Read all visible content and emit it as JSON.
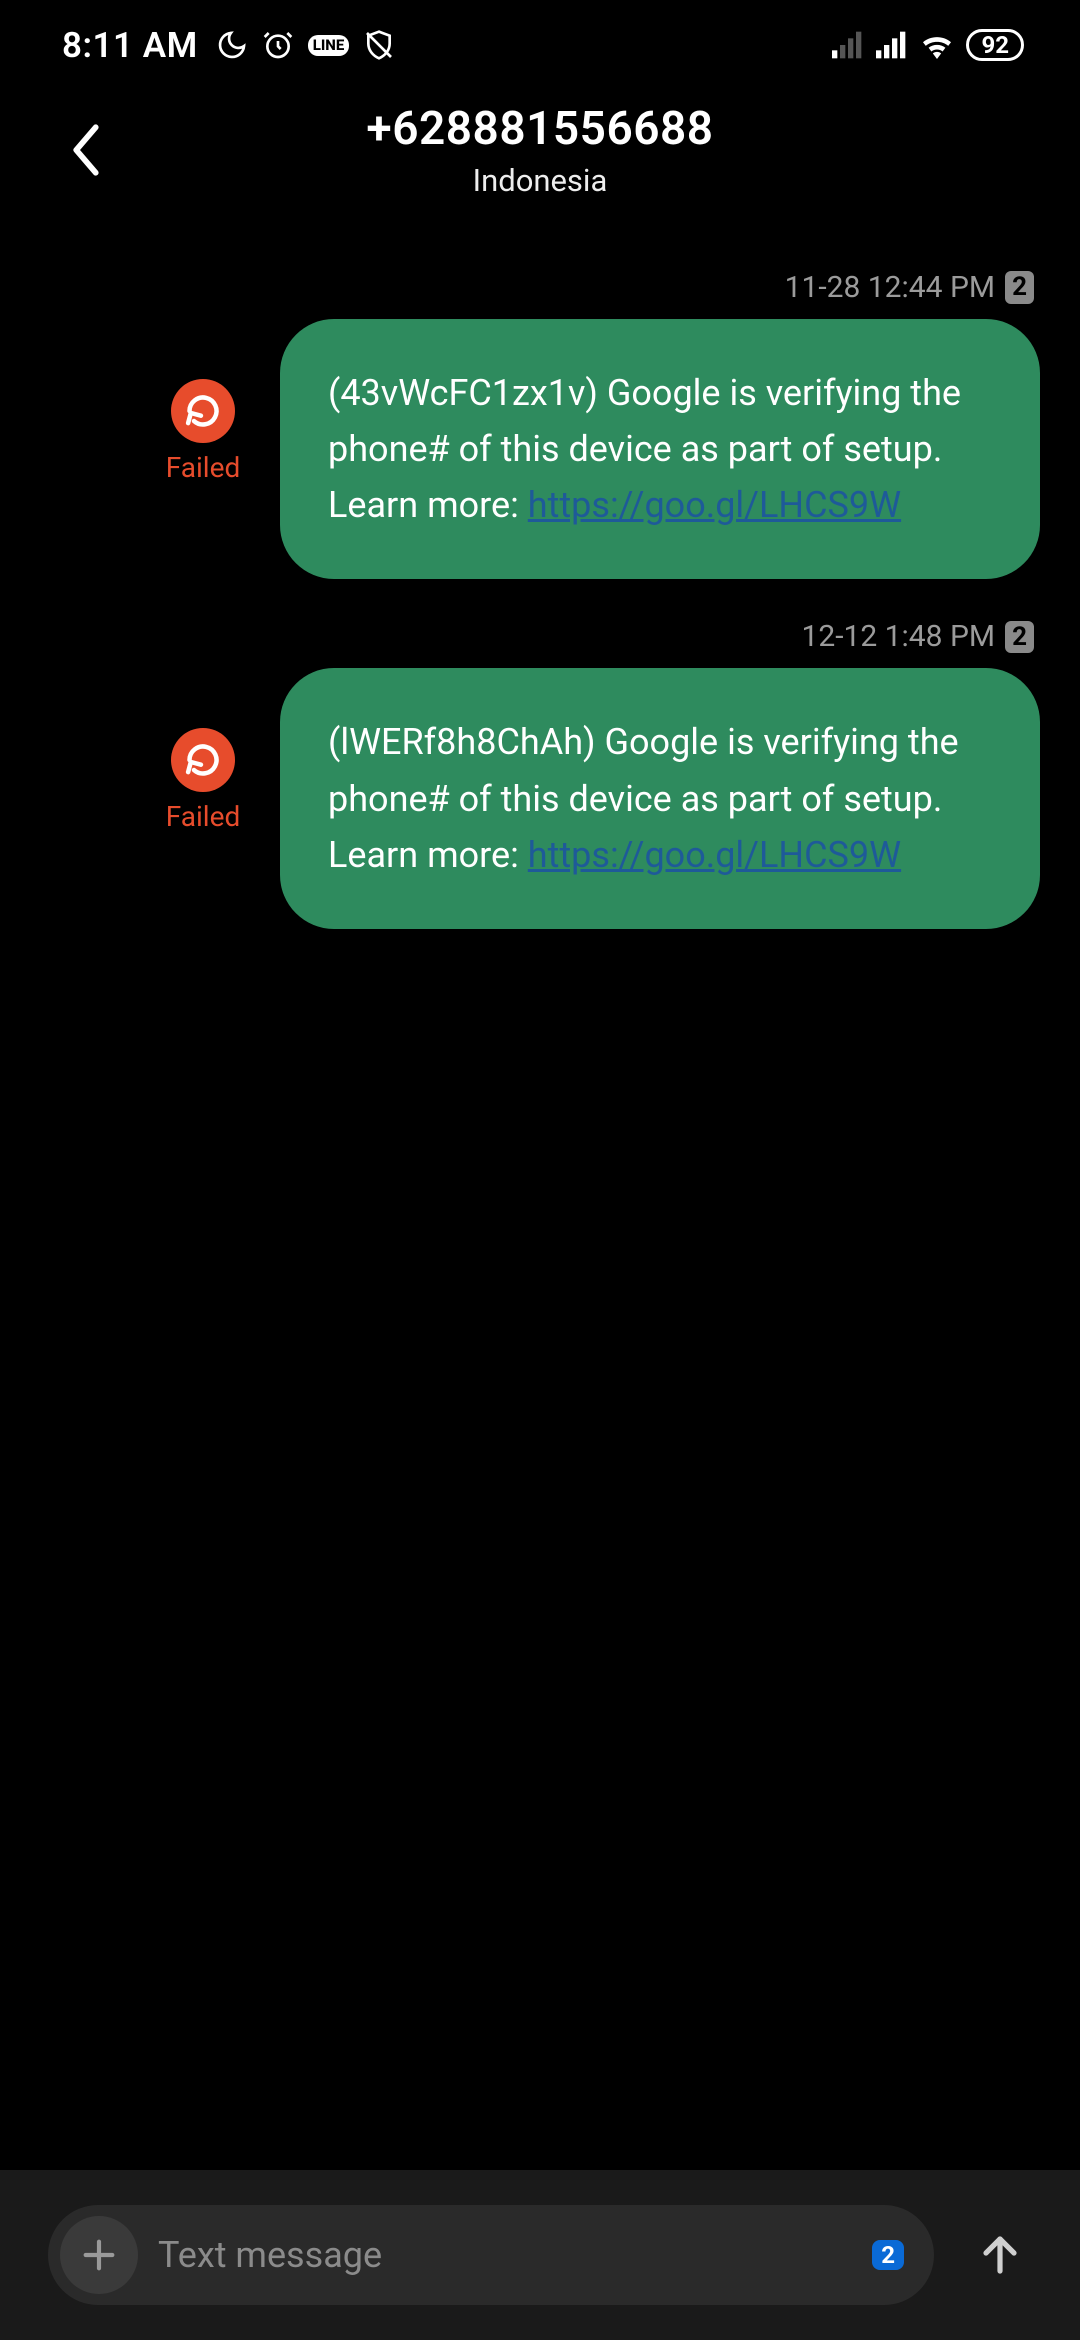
{
  "status": {
    "time": "8:11 AM",
    "battery": "92",
    "icons": {
      "moon": "moon-icon",
      "alarm": "alarm-icon",
      "line": "LINE",
      "shield": "shield-icon",
      "signal1": "signal-weak-icon",
      "signal2": "signal-icon",
      "wifi": "wifi-icon"
    }
  },
  "header": {
    "number": "+628881556688",
    "region": "Indonesia"
  },
  "messages": [
    {
      "time": "11-28 12:44 PM",
      "sim": "2",
      "failed_label": "Failed",
      "text": "(43vWcFC1zx1v) Google is verifying the phone# of this device as part of setup. Learn more: ",
      "link": "https://goo.gl/LHCS9W"
    },
    {
      "time": "12-12 1:48 PM",
      "sim": "2",
      "failed_label": "Failed",
      "text": "(lWERf8h8ChAh) Google is verifying the phone# of this device as part of setup. Learn more: ",
      "link": "https://goo.gl/LHCS9W"
    }
  ],
  "composer": {
    "placeholder": "Text message",
    "sim": "2"
  }
}
